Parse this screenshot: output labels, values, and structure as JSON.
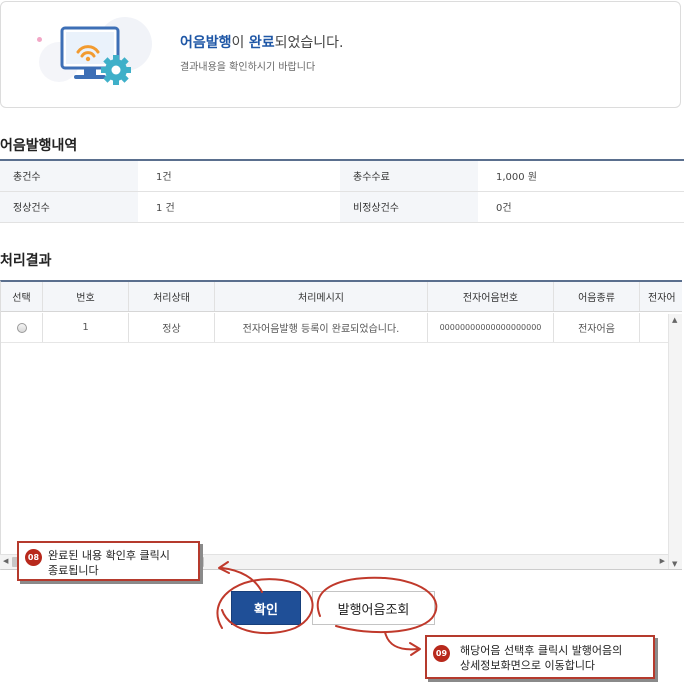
{
  "banner": {
    "title_part1": "어음발행",
    "title_part2": "이 ",
    "title_part3": "완료",
    "title_part4": "되었습니다.",
    "subtitle": "결과내용을 확인하시기 바랍니다",
    "icon": "monitor-wifi-gear-icon"
  },
  "issue_section": {
    "title": "어음발행내역",
    "rows": [
      [
        {
          "label": "총건수",
          "value": "1건"
        },
        {
          "label": "총수수료",
          "value": "1,000 원"
        }
      ],
      [
        {
          "label": "정상건수",
          "value": "1 건"
        },
        {
          "label": "비정상건수",
          "value": "0건"
        }
      ]
    ]
  },
  "result_section": {
    "title": "처리결과",
    "columns": [
      "선택",
      "번호",
      "처리상태",
      "처리메시지",
      "전자어음번호",
      "어음종류",
      "전자어"
    ],
    "rows": [
      {
        "number": "1",
        "status": "정상",
        "message": "전자어음발행 등록이 완료되었습니다.",
        "bill_no": "00000000000000000000",
        "bill_type": "전자어음"
      }
    ]
  },
  "buttons": {
    "confirm": "확인",
    "query": "발행어음조회"
  },
  "callouts": {
    "c08": {
      "num": "08",
      "line1": "완료된 내용 확인후 클릭시",
      "line2": "종료됩니다"
    },
    "c09": {
      "num": "09",
      "line1": "해당어음 선택후 클릭시 발행어음의",
      "line2": "상세정보화면으로 이동합니다"
    }
  },
  "colors": {
    "accent": "#1f4f97",
    "annotation": "#c0392b"
  }
}
